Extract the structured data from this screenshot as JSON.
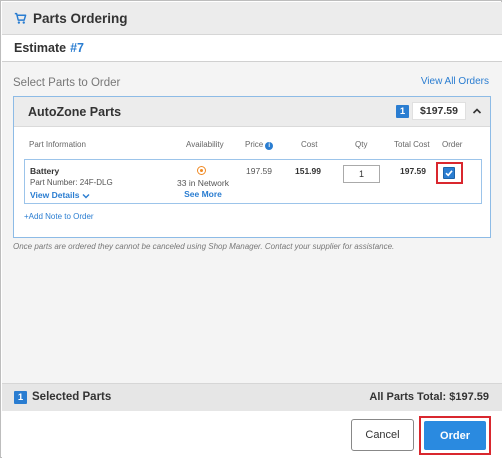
{
  "dialog": {
    "title": "Parts Ordering",
    "estimate_label": "Estimate",
    "estimate_number": "#7"
  },
  "section": {
    "select_label": "Select Parts to Order",
    "view_all_orders": "View All Orders"
  },
  "supplier": {
    "name": "AutoZone Parts",
    "count": "1",
    "total": "$197.59",
    "columns": {
      "part_information": "Part Information",
      "availability": "Availability",
      "price": "Price",
      "cost": "Cost",
      "qty": "Qty",
      "total_cost": "Total Cost",
      "order": "Order"
    },
    "part": {
      "name": "Battery",
      "part_number": "Part Number: 24F-DLG",
      "view_details": "View Details",
      "network": "33 in Network",
      "see_more": "See More",
      "price": "197.59",
      "cost": "151.99",
      "qty": "1",
      "total_cost": "197.59",
      "order_checked": true
    },
    "add_note": "+Add Note to Order"
  },
  "disclaimer": "Once parts are ordered they cannot be canceled using Shop Manager. Contact your supplier for assistance.",
  "summary": {
    "selected_count": "1",
    "selected_label": "Selected Parts",
    "all_parts_total": "All Parts Total: $197.59"
  },
  "footer": {
    "cancel_label": "Cancel",
    "order_label": "Order"
  },
  "colors": {
    "accent": "#2a7dd1",
    "highlight": "#d9272e",
    "availability": "#f08a24"
  },
  "icons": {
    "title": "cart-icon",
    "collapse": "chevron-up-icon",
    "details": "chevron-down-icon",
    "price_info": "info-icon",
    "availability": "radio-dot-icon",
    "order": "check-icon"
  }
}
